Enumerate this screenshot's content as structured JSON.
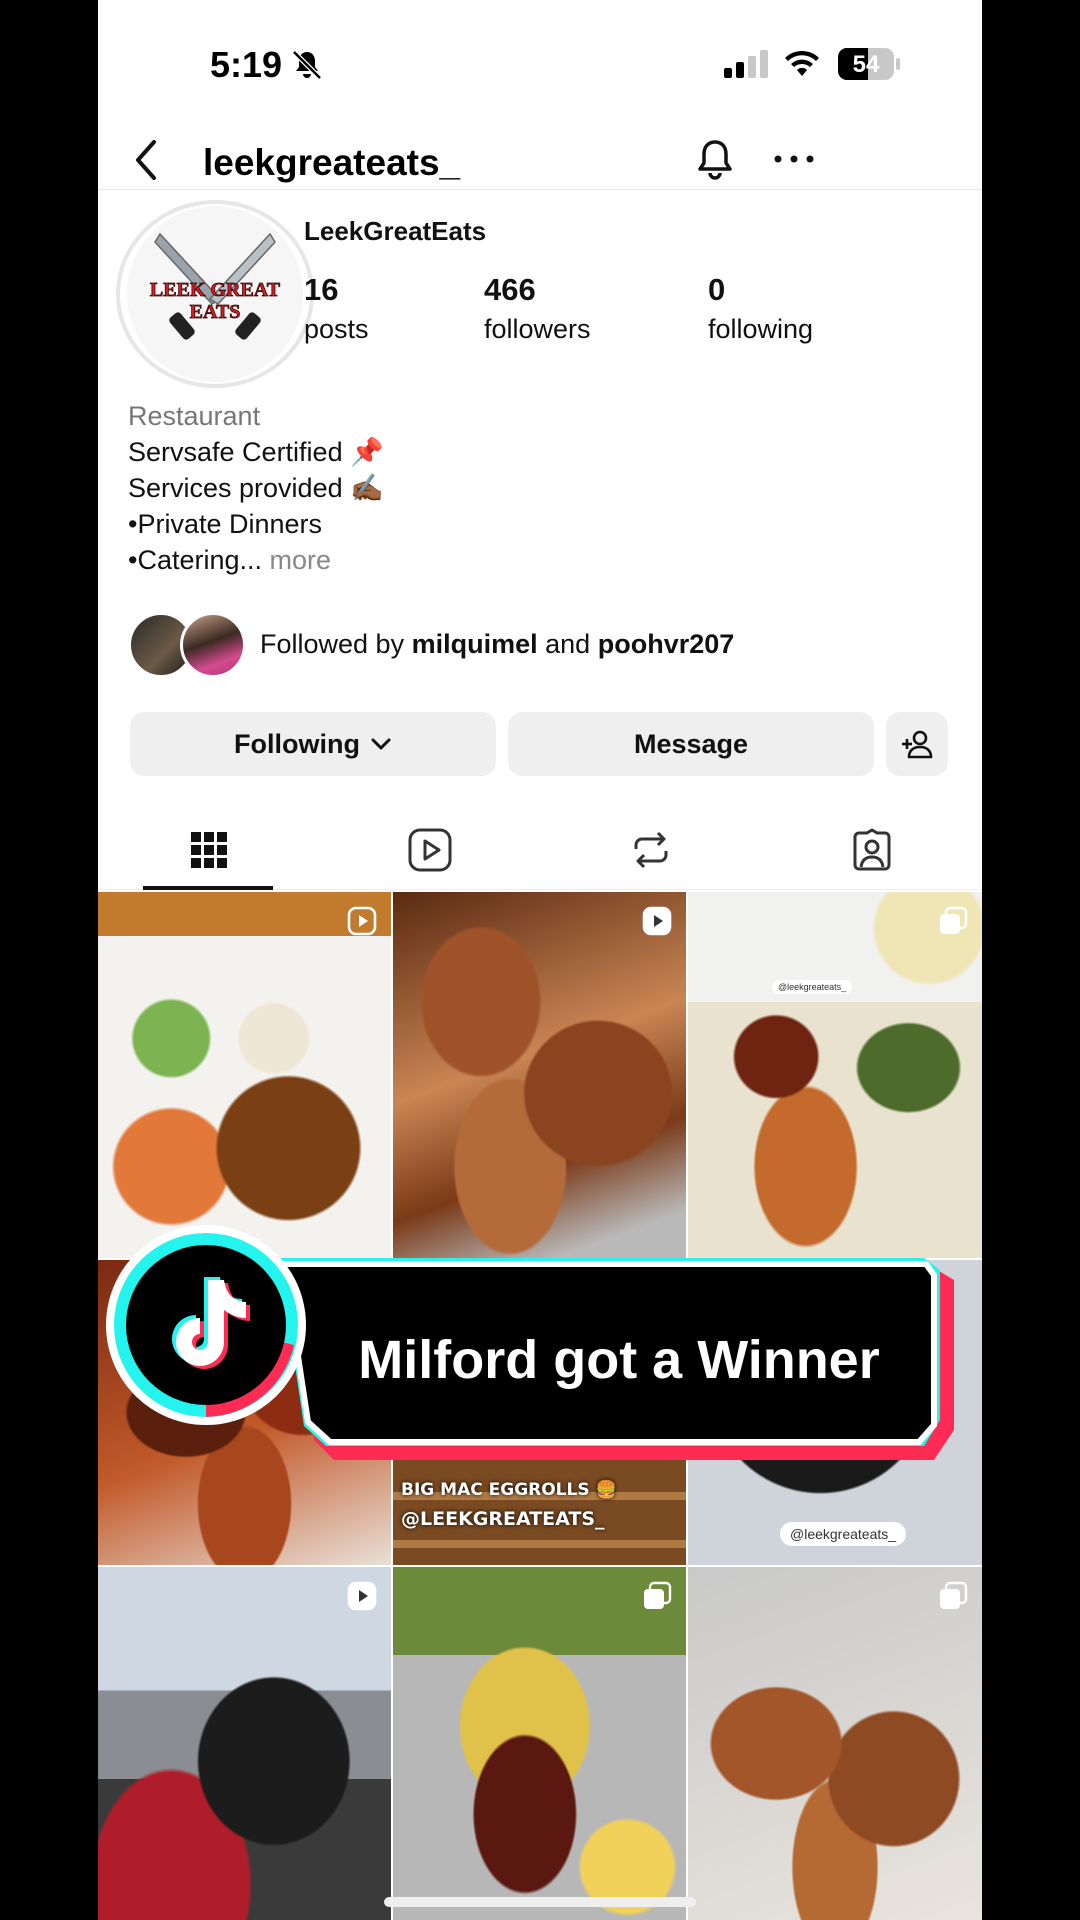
{
  "status_bar": {
    "time": "5:19",
    "battery": "54",
    "battery_level": 0.54
  },
  "header": {
    "username": "leekgreateats_"
  },
  "profile": {
    "avatar_text_line1": "LEEK GREAT",
    "avatar_text_line2": "EATS",
    "display_name": "LeekGreatEats",
    "stats": [
      {
        "value": "16",
        "label": "posts"
      },
      {
        "value": "466",
        "label": "followers"
      },
      {
        "value": "0",
        "label": "following"
      }
    ],
    "bio": {
      "category": "Restaurant",
      "line1": "Servsafe Certified 📌",
      "line2": "Services provided ✍🏾",
      "line3": "•Private Dinners",
      "line4": "•Catering...",
      "more": "more"
    },
    "followed_by": {
      "prefix": "Followed by",
      "user1": "milquimel",
      "joiner": "and",
      "user2": "poohvr207"
    }
  },
  "actions": {
    "following": "Following",
    "message": "Message"
  },
  "tabs": [
    "grid-icon",
    "reels-icon",
    "reposts-icon",
    "tagged-icon"
  ],
  "posts": {
    "tag_small": "@leekgreateats_",
    "caption_line1": "BIG MAC EGGROLLS 🍔",
    "caption_line2": "@LEEKGREATEATS_",
    "tag_pill": "@leekgreateats_"
  },
  "overlay": {
    "text": "Milford got a Winner"
  },
  "colors": {
    "tiktok_cyan": "#25f4ee",
    "tiktok_red": "#fe2c55",
    "button_bg": "#efefef"
  }
}
